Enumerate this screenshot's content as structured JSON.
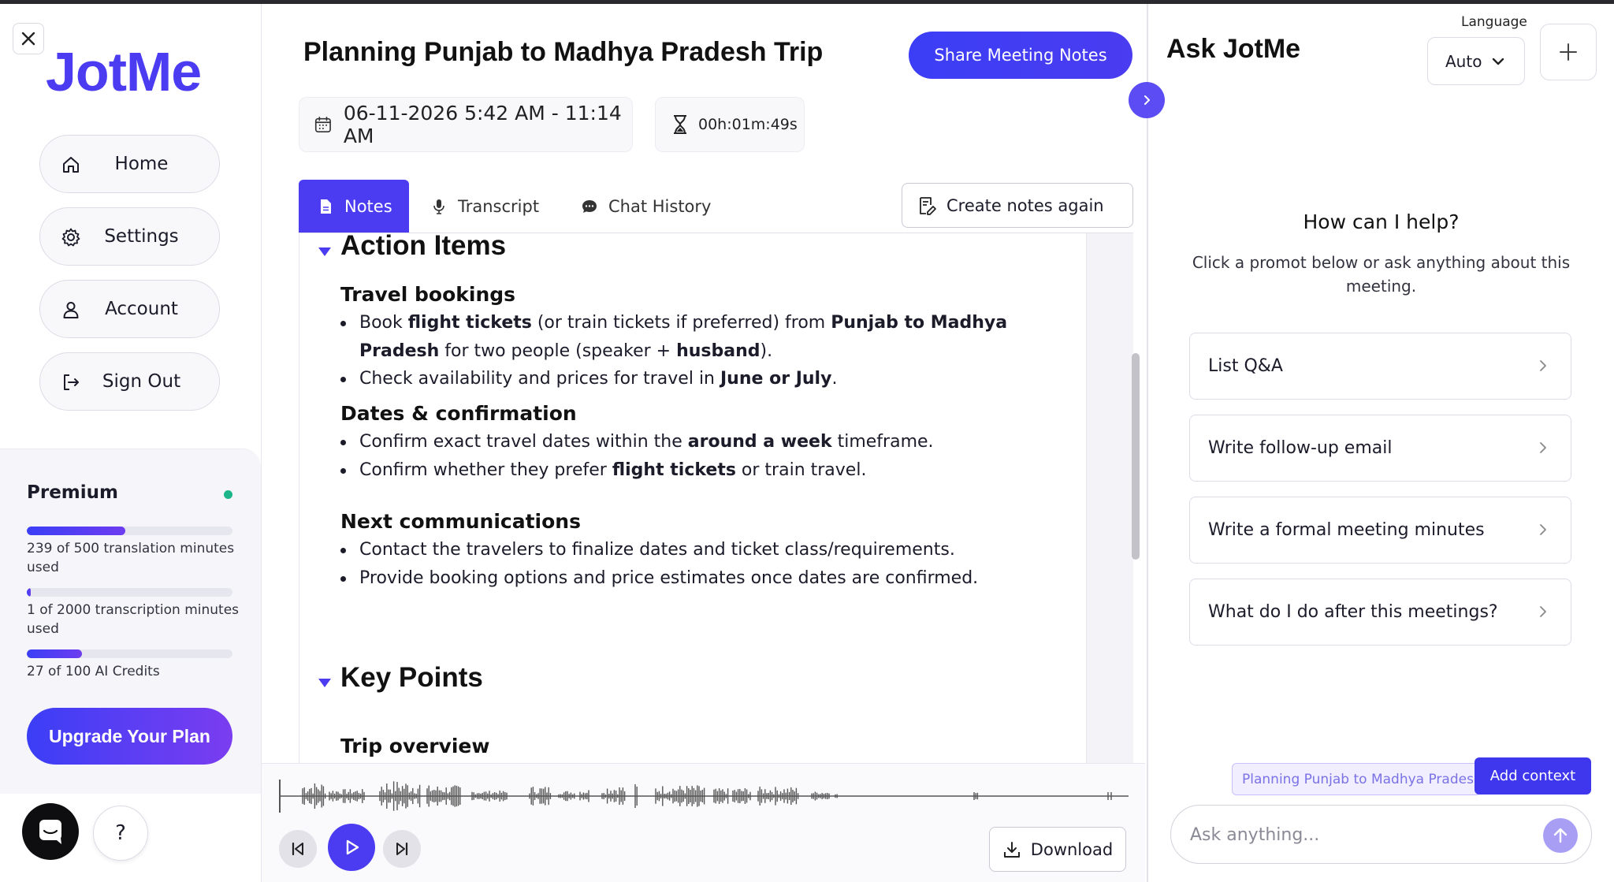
{
  "sidebar": {
    "logo": "JotMe",
    "nav": [
      {
        "label": "Home",
        "icon": "home-icon"
      },
      {
        "label": "Settings",
        "icon": "gear-icon"
      },
      {
        "label": "Account",
        "icon": "user-icon"
      },
      {
        "label": "Sign Out",
        "icon": "sign-out-icon"
      }
    ],
    "plan": {
      "name": "Premium",
      "status_color": "#1fb58a",
      "translation": {
        "text": "239 of 500 translation minutes used",
        "used": 239,
        "total": 500
      },
      "transcription": {
        "text": "1 of 2000 transcription minutes used",
        "used": 1,
        "total": 2000
      },
      "credits": {
        "text": "27 of 100 AI Credits",
        "used": 27,
        "total": 100
      },
      "upgrade_label": "Upgrade Your Plan"
    },
    "help_label": "?"
  },
  "meeting": {
    "title": "Planning Punjab to Madhya Pradesh Trip",
    "share_label": "Share Meeting Notes",
    "datetime": "06-11-2026 5:42 AM - 11:14 AM",
    "duration": "00h:01m:49s",
    "tabs": [
      {
        "label": "Notes",
        "icon": "document-icon",
        "active": true
      },
      {
        "label": "Transcript",
        "icon": "microphone-icon",
        "active": false
      },
      {
        "label": "Chat History",
        "icon": "chat-icon",
        "active": false
      }
    ],
    "recreate_label": "Create notes again",
    "download_label": "Download"
  },
  "notes": {
    "action_items": {
      "heading": "Action Items",
      "groups": [
        {
          "title": "Travel bookings",
          "bullets": [
            {
              "parts": [
                [
                  "Book ",
                  false
                ],
                [
                  "flight tickets",
                  true
                ],
                [
                  " (or train tickets if preferred) from ",
                  false
                ],
                [
                  "Punjab to Madhya Pradesh",
                  true
                ],
                [
                  " for two people (speaker + ",
                  false
                ],
                [
                  "husband",
                  true
                ],
                [
                  ").",
                  false
                ]
              ]
            },
            {
              "parts": [
                [
                  "Check availability and prices for travel in ",
                  false
                ],
                [
                  "June or July",
                  true
                ],
                [
                  ".",
                  false
                ]
              ]
            }
          ]
        },
        {
          "title": "Dates & confirmation",
          "bullets": [
            {
              "parts": [
                [
                  "Confirm exact travel dates within the ",
                  false
                ],
                [
                  "around a week",
                  true
                ],
                [
                  " timeframe.",
                  false
                ]
              ]
            },
            {
              "parts": [
                [
                  "Confirm whether they prefer ",
                  false
                ],
                [
                  "flight tickets",
                  true
                ],
                [
                  " or train travel.",
                  false
                ]
              ]
            }
          ]
        },
        {
          "title": "Next communications",
          "bullets": [
            {
              "parts": [
                [
                  "Contact the travelers to finalize dates and ticket class/requirements.",
                  false
                ]
              ]
            },
            {
              "parts": [
                [
                  "Provide booking options and price estimates once dates are confirmed.",
                  false
                ]
              ]
            }
          ]
        }
      ]
    },
    "key_points": {
      "heading": "Key Points",
      "first_group": "Trip overview"
    }
  },
  "assistant": {
    "title": "Ask JotMe",
    "language_label": "Language",
    "language_value": "Auto",
    "help_heading": "How can I help?",
    "help_sub": "Click a promot below or ask anything about this meeting.",
    "prompts": [
      "List Q&A",
      "Write follow-up email",
      "Write a formal meeting minutes",
      "What do I do after this meetings?"
    ],
    "context_chip": "Planning Punjab to Madhya Prades",
    "add_context_label": "Add context",
    "input_placeholder": "Ask anything..."
  },
  "colors": {
    "accent": "#4b3cf2",
    "accent_light": "#a89ff5"
  }
}
